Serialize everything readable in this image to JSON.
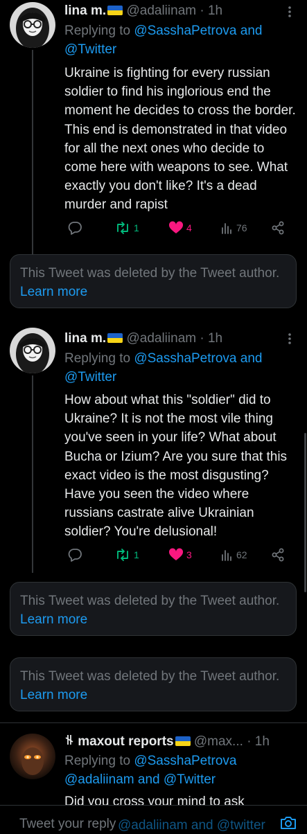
{
  "tweets": [
    {
      "name": "lina m.",
      "handle": "@adaliinam",
      "dot": "·",
      "time": "1h",
      "replying_label": "Replying to",
      "replying_mentions": "@SasshaPetrova and @Twitter",
      "text": "Ukraine is fighting for every russian soldier to find his inglorious end the moment he decides to cross the border. This end is demonstrated in that video for all the next ones who decide to come here with weapons to see. What exactly you don't like? It's a dead murder and rapist",
      "actions": {
        "replies": "",
        "retweets": "1",
        "likes": "4",
        "views": "76"
      }
    },
    {
      "name": "lina m.",
      "handle": "@adaliinam",
      "dot": "·",
      "time": "1h",
      "replying_label": "Replying to",
      "replying_mentions": "@SasshaPetrova and @Twitter",
      "text": "How about what this \"soldier\" did to Ukraine? It is not the most vile thing you've seen in your life? What about Bucha or Izium? Are you sure that this exact video is the most disgusting? Have you seen the video where russians castrate alive Ukrainian soldier? You're delusional!",
      "actions": {
        "replies": "",
        "retweets": "1",
        "likes": "3",
        "views": "62"
      }
    },
    {
      "name": "maxout reports",
      "handle": "@max...",
      "dot": "·",
      "time": "1h",
      "replying_label": "Replying to",
      "replying_mentions": "@SasshaPetrova @adaliinam and @Twitter",
      "text": "Did you cross your mind to ask"
    }
  ],
  "deleted_notice": {
    "text": "This Tweet was deleted by the Tweet author.",
    "link": "Learn more"
  },
  "composer": {
    "placeholder": "Tweet your reply",
    "overlay_mentions": "@adaliinam and @twitter"
  },
  "colors": {
    "background": "#000000",
    "accent": "#1d9bf0",
    "retweet": "#00ba7c",
    "like": "#f91880",
    "muted": "#71767b"
  }
}
